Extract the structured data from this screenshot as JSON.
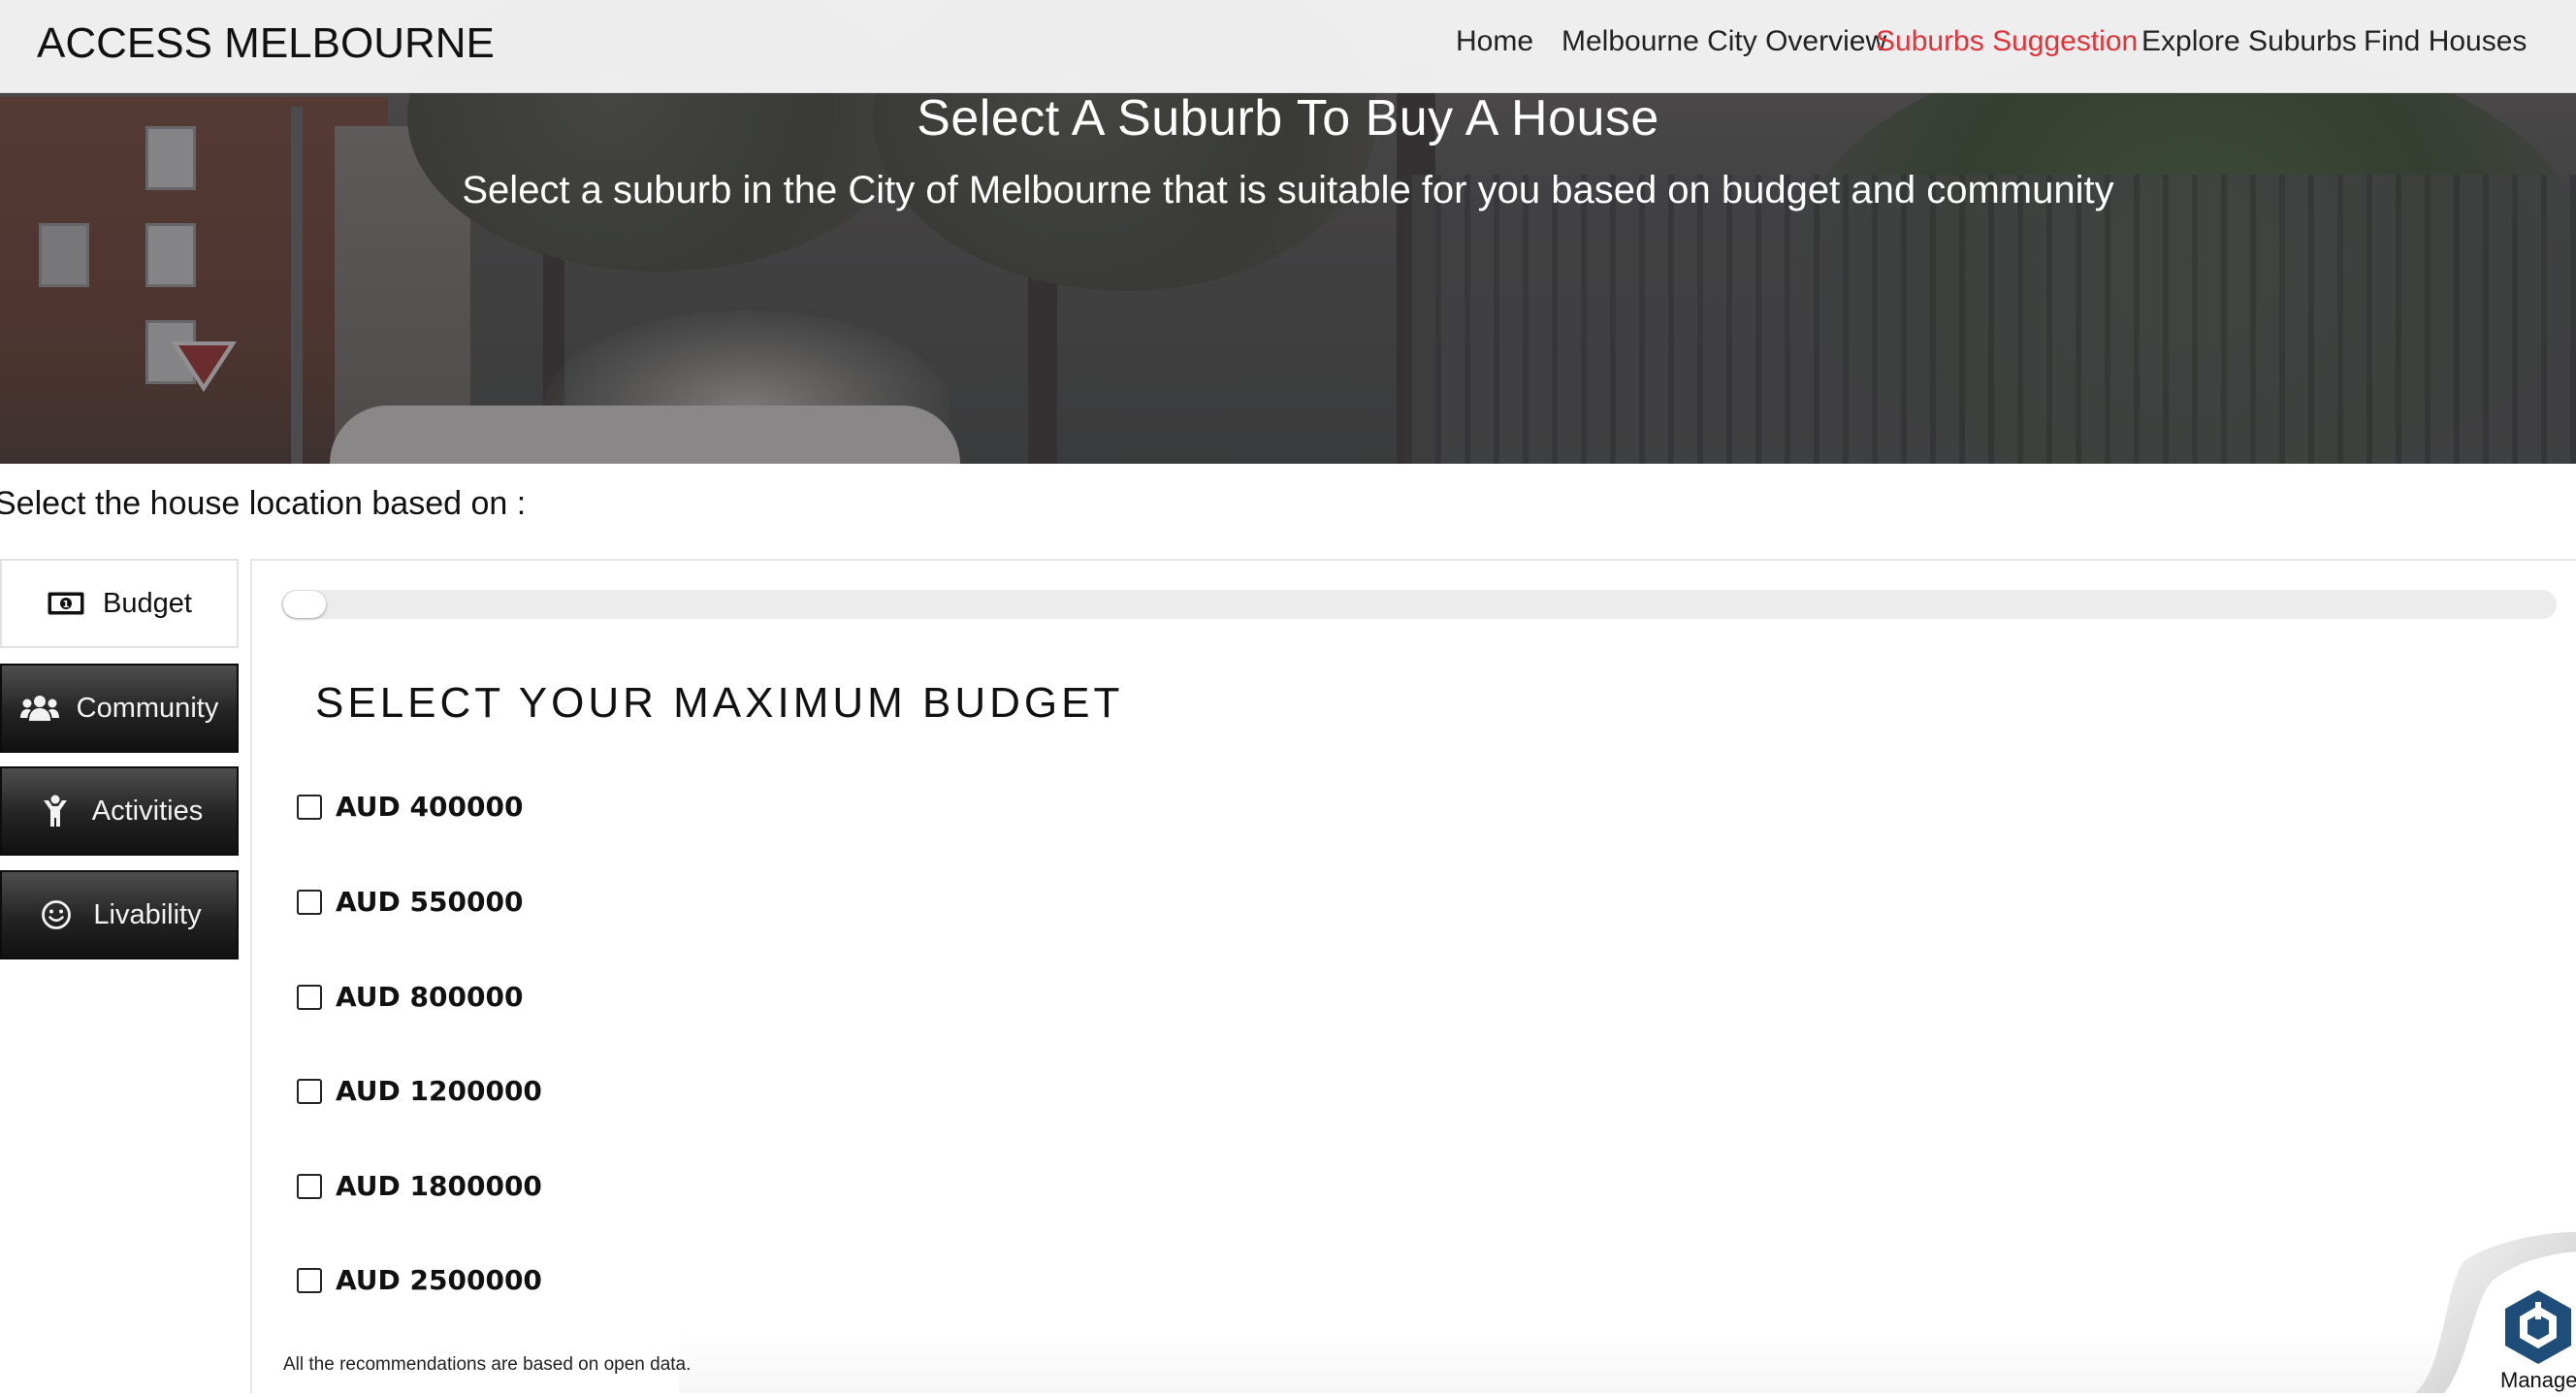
{
  "brand": "ACCESS MELBOURNE",
  "nav": {
    "items": [
      {
        "label": "Home",
        "active": false
      },
      {
        "label": "Melbourne City Overview",
        "active": false
      },
      {
        "label": "Suburbs Suggestion",
        "active": true
      },
      {
        "label": "Explore Suburbs",
        "active": false
      },
      {
        "label": "Find Houses",
        "active": false
      }
    ],
    "active_color": "#e0343c"
  },
  "hero": {
    "title": "Select A Suburb To Buy A House",
    "subtitle": "Select a suburb in the City of Melbourne that is suitable for you based on budget and community"
  },
  "selection": {
    "label": "Select the house location based on :"
  },
  "tabs": [
    {
      "label": "Budget",
      "icon": "money-bill-icon",
      "selected": true
    },
    {
      "label": "Community",
      "icon": "users-icon",
      "selected": false
    },
    {
      "label": "Activities",
      "icon": "child-icon",
      "selected": false
    },
    {
      "label": "Livability",
      "icon": "smile-icon",
      "selected": false
    }
  ],
  "progress": {
    "value": 0
  },
  "budget": {
    "heading": "SELECT YOUR MAXIMUM BUDGET",
    "options": [
      {
        "label": "AUD 400000",
        "checked": false
      },
      {
        "label": "AUD 550000",
        "checked": false
      },
      {
        "label": "AUD 800000",
        "checked": false
      },
      {
        "label": "AUD 1200000",
        "checked": false
      },
      {
        "label": "AUD 1800000",
        "checked": false
      },
      {
        "label": "AUD 2500000",
        "checked": false
      }
    ]
  },
  "footnote": "All the recommendations are based on open data.",
  "widget": {
    "label": "Manage",
    "icon": "hexagon-logo-icon"
  }
}
